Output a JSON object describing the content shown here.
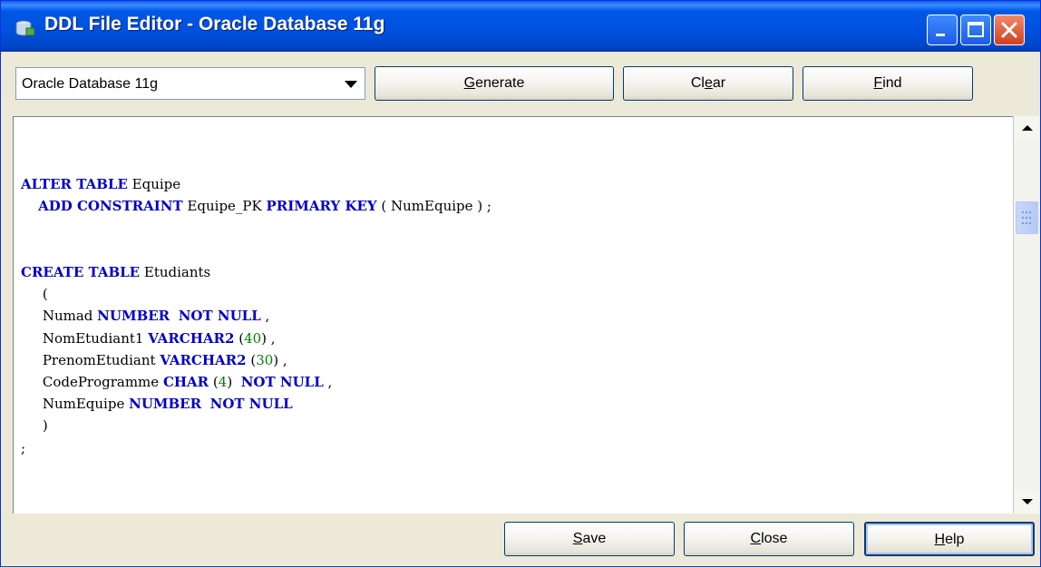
{
  "window": {
    "title": "DDL File Editor - Oracle Database 11g"
  },
  "toolbar": {
    "database_select": "Oracle Database 11g",
    "generate_label": "Generate",
    "clear_label": "Clear",
    "find_label": "Find"
  },
  "editor": {
    "lines": [
      [],
      [
        {
          "t": "ALTER TABLE",
          "c": "kw"
        },
        {
          "t": " Equipe",
          "c": ""
        }
      ],
      [
        {
          "t": "    ",
          "c": ""
        },
        {
          "t": "ADD CONSTRAINT",
          "c": "kw"
        },
        {
          "t": " Equipe_PK ",
          "c": ""
        },
        {
          "t": "PRIMARY KEY",
          "c": "kw"
        },
        {
          "t": " ( NumEquipe ) ;",
          "c": ""
        }
      ],
      [],
      [],
      [
        {
          "t": "CREATE TABLE",
          "c": "kw"
        },
        {
          "t": " Etudiants",
          "c": ""
        }
      ],
      [
        {
          "t": "     (",
          "c": ""
        }
      ],
      [
        {
          "t": "     Numad ",
          "c": ""
        },
        {
          "t": "NUMBER",
          "c": "kw"
        },
        {
          "t": "  ",
          "c": ""
        },
        {
          "t": "NOT NULL",
          "c": "kw"
        },
        {
          "t": " ,",
          "c": ""
        }
      ],
      [
        {
          "t": "     NomEtudiant1 ",
          "c": ""
        },
        {
          "t": "VARCHAR2",
          "c": "kw"
        },
        {
          "t": " (",
          "c": ""
        },
        {
          "t": "40",
          "c": "num"
        },
        {
          "t": ") ,",
          "c": ""
        }
      ],
      [
        {
          "t": "     PrenomEtudiant ",
          "c": ""
        },
        {
          "t": "VARCHAR2",
          "c": "kw"
        },
        {
          "t": " (",
          "c": ""
        },
        {
          "t": "30",
          "c": "num"
        },
        {
          "t": ") ,",
          "c": ""
        }
      ],
      [
        {
          "t": "     CodeProgramme ",
          "c": ""
        },
        {
          "t": "CHAR",
          "c": "kw"
        },
        {
          "t": " (",
          "c": ""
        },
        {
          "t": "4",
          "c": "num"
        },
        {
          "t": ")  ",
          "c": ""
        },
        {
          "t": "NOT NULL",
          "c": "kw"
        },
        {
          "t": " ,",
          "c": ""
        }
      ],
      [
        {
          "t": "     NumEquipe ",
          "c": ""
        },
        {
          "t": "NUMBER",
          "c": "kw"
        },
        {
          "t": "  ",
          "c": ""
        },
        {
          "t": "NOT NULL",
          "c": "kw"
        }
      ],
      [
        {
          "t": "     )",
          "c": ""
        }
      ],
      [
        {
          "t": ";",
          "c": ""
        }
      ]
    ]
  },
  "footer": {
    "save_label": "Save",
    "close_label": "Close",
    "help_label": "Help"
  },
  "icons": {
    "title": "database-icon",
    "minimize": "minimize-icon",
    "maximize": "maximize-icon",
    "close": "close-icon",
    "dropdown": "chevron-down-icon",
    "scroll_up": "scroll-up-arrow-icon",
    "scroll_down": "scroll-down-arrow-icon"
  },
  "colors": {
    "keyword": "#0000cc",
    "number": "#008000",
    "titlebar": "#0054e3"
  }
}
